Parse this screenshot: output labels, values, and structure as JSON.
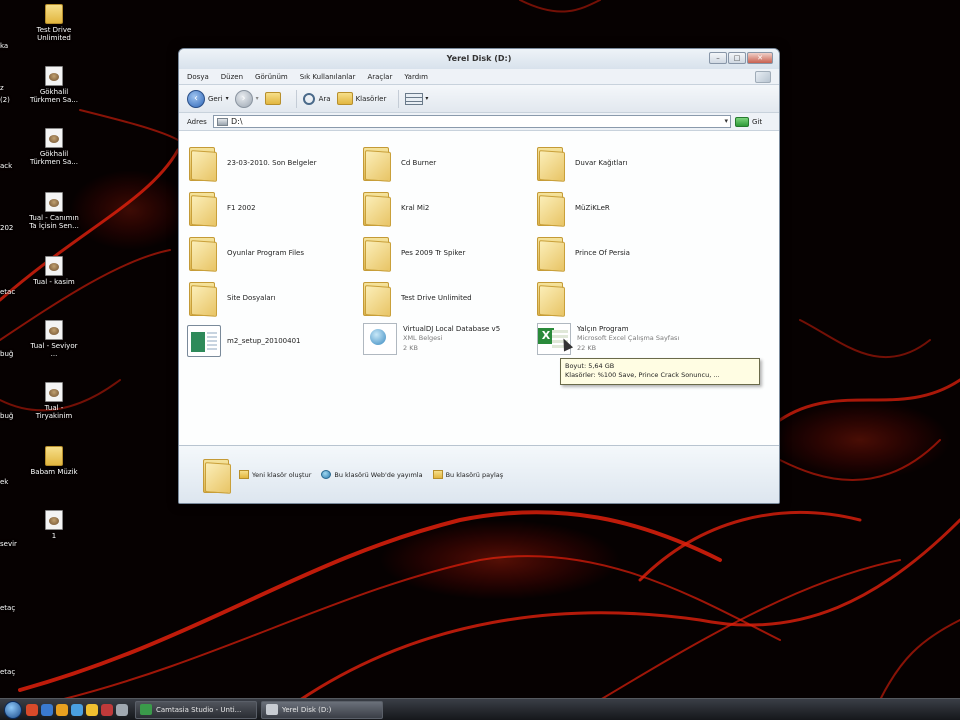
{
  "window": {
    "title": "Yerel Disk (D:)",
    "controls": {
      "minimize": "–",
      "maximize": "□",
      "close": "✕"
    }
  },
  "menu": [
    "Dosya",
    "Düzen",
    "Görünüm",
    "Sık Kullanılanlar",
    "Araçlar",
    "Yardım"
  ],
  "toolbar": {
    "back_label": "Geri",
    "search_label": "Ara",
    "folders_label": "Klasörler"
  },
  "address": {
    "label": "Adres",
    "value": "D:\\",
    "go_label": "Git"
  },
  "items": [
    {
      "type": "folder",
      "name": "23-03-2010. Son Belgeler"
    },
    {
      "type": "folder",
      "name": "Cd Burner"
    },
    {
      "type": "folder",
      "name": "Duvar Kağıtları"
    },
    {
      "type": "folder",
      "name": "F1 2002"
    },
    {
      "type": "folder",
      "name": "Kral Mi2"
    },
    {
      "type": "folder",
      "name": "MüZiKLeR"
    },
    {
      "type": "folder",
      "name": "Oyunlar Program Files"
    },
    {
      "type": "folder",
      "name": "Pes 2009 Tr Spiker"
    },
    {
      "type": "folder",
      "name": "Prince Of Persia"
    },
    {
      "type": "folder",
      "name": "Site Dosyaları"
    },
    {
      "type": "folder",
      "name": "Test Drive Unlimited"
    },
    {
      "type": "folder",
      "name": ""
    },
    {
      "type": "setup",
      "name": "m2_setup_20100401"
    },
    {
      "type": "xml",
      "name": "VirtualDJ Local Database v5",
      "kind": "XML Belgesi",
      "size": "2 KB"
    },
    {
      "type": "excel",
      "name": "Yalçın Program",
      "kind": "Microsoft Excel Çalışma Sayfası",
      "size": "22 KB"
    }
  ],
  "tooltip": {
    "line1": "Boyut: 5,64 GB",
    "line2": "Klasörler: %100 Save, Prince Crack Sonuncu, ..."
  },
  "tasks": [
    "Yeni klasör oluştur",
    "Bu klasörü Web'de yayımla",
    "Bu klasörü paylaş"
  ],
  "desktop_icons": [
    {
      "label": "Test Drive Unlimited",
      "icon": "folder-icon"
    },
    {
      "label": "Gökhalil Türkmen Sa...",
      "icon": "shortcut-icon"
    },
    {
      "label": "Gökhalil Türkmen Sa...",
      "icon": "shortcut-icon"
    },
    {
      "label": "Tual - Canımın Ta İçisin Sen...",
      "icon": "shortcut-icon"
    },
    {
      "label": "Tual - kasim",
      "icon": "shortcut-icon"
    },
    {
      "label": "Tual - Seviyor ...",
      "icon": "shortcut-icon"
    },
    {
      "label": "Tual - Tiryakinim",
      "icon": "shortcut-icon"
    },
    {
      "label": "Babam Müzik",
      "icon": "folder-icon"
    },
    {
      "label": "1",
      "icon": "shortcut-icon"
    }
  ],
  "desktop_edge_labels": [
    "ka",
    "z",
    "(2)",
    "ack",
    "202",
    "etac",
    "buğ",
    "buğ",
    "ek",
    "sevir",
    "etaç",
    "etaç"
  ],
  "taskbar": {
    "buttons": [
      {
        "label": "Camtasia Studio - Unti...",
        "active": false
      },
      {
        "label": "Yerel Disk (D:)",
        "active": true
      }
    ]
  }
}
